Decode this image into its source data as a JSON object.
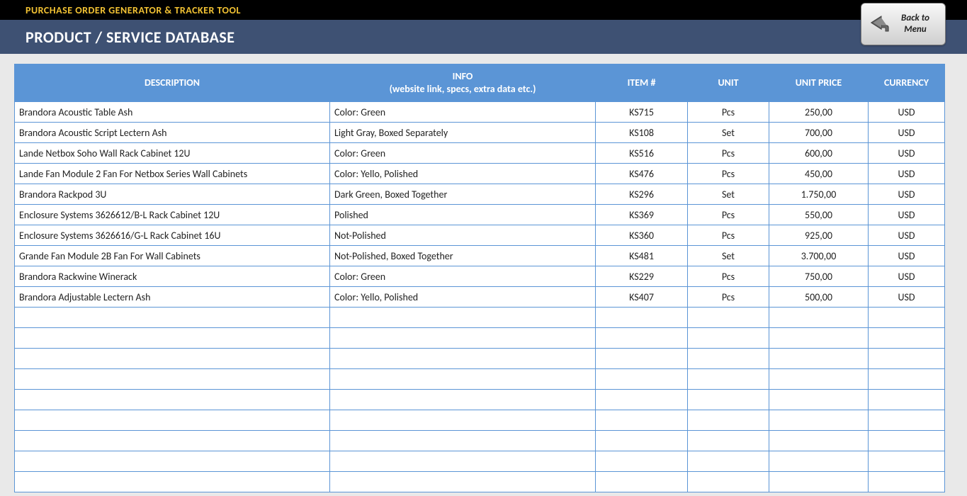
{
  "header": {
    "app_title": "PURCHASE ORDER GENERATOR & TRACKER TOOL",
    "page_title": "PRODUCT / SERVICE DATABASE",
    "back_button": "Back to\nMenu"
  },
  "table": {
    "columns": {
      "description": "DESCRIPTION",
      "info": "INFO",
      "info_sub": "(website link, specs, extra data etc.)",
      "item": "ITEM #",
      "unit": "UNIT",
      "price": "UNIT PRICE",
      "currency": "CURRENCY"
    },
    "rows": [
      {
        "description": "Brandora Acoustic Table Ash",
        "info": "Color: Green",
        "item": "KS715",
        "unit": "Pcs",
        "price": "250,00",
        "currency": "USD"
      },
      {
        "description": "Brandora Acoustic Script Lectern Ash",
        "info": "Light Gray, Boxed Separately",
        "item": "KS108",
        "unit": "Set",
        "price": "700,00",
        "currency": "USD"
      },
      {
        "description": "Lande Netbox Soho Wall Rack Cabinet 12U",
        "info": "Color: Green",
        "item": "KS516",
        "unit": "Pcs",
        "price": "600,00",
        "currency": "USD"
      },
      {
        "description": "Lande Fan Module 2 Fan For Netbox Series Wall Cabinets",
        "info": "Color: Yello, Polished",
        "item": "KS476",
        "unit": "Pcs",
        "price": "450,00",
        "currency": "USD"
      },
      {
        "description": "Brandora Rackpod 3U",
        "info": "Dark Green, Boxed Together",
        "item": "KS296",
        "unit": "Set",
        "price": "1.750,00",
        "currency": "USD"
      },
      {
        "description": "Enclosure Systems 3626612/B-L Rack Cabinet 12U",
        "info": "Polished",
        "item": "KS369",
        "unit": "Pcs",
        "price": "550,00",
        "currency": "USD"
      },
      {
        "description": "Enclosure Systems 3626616/G-L Rack Cabinet 16U",
        "info": "Not-Polished",
        "item": "KS360",
        "unit": "Pcs",
        "price": "925,00",
        "currency": "USD"
      },
      {
        "description": "Grande Fan Module 2B Fan For Wall Cabinets",
        "info": "Not-Polished, Boxed Together",
        "item": "KS481",
        "unit": "Set",
        "price": "3.700,00",
        "currency": "USD"
      },
      {
        "description": "Brandora Rackwine Winerack",
        "info": "Color: Green",
        "item": "KS229",
        "unit": "Pcs",
        "price": "750,00",
        "currency": "USD"
      },
      {
        "description": "Brandora Adjustable Lectern Ash",
        "info": "Color: Yello, Polished",
        "item": "KS407",
        "unit": "Pcs",
        "price": "500,00",
        "currency": "USD"
      }
    ],
    "empty_rows": 9
  }
}
